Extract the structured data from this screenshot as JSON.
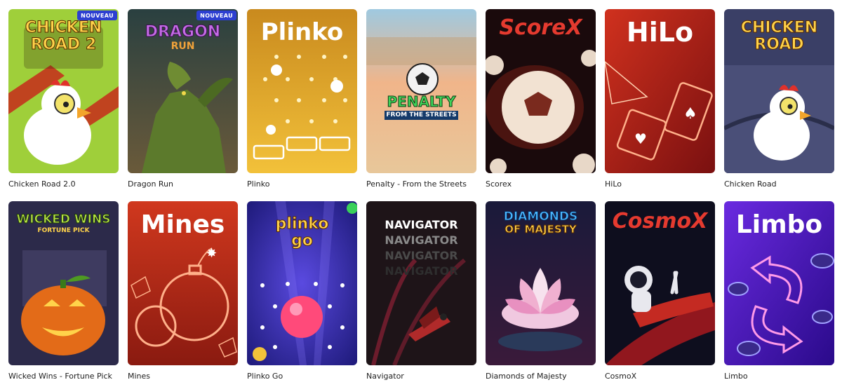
{
  "badge_new": "NOUVEAU",
  "games": [
    {
      "title": "Chicken Road 2.0",
      "logo": "CHICKEN",
      "logo2": "ROAD 2",
      "icon": "chicken-icon"
    },
    {
      "title": "Dragon Run",
      "logo": "DRAGON",
      "logo2": "RUN",
      "icon": "dragon-icon"
    },
    {
      "title": "Plinko",
      "logo": "Plinko",
      "icon": "plinko-board-icon"
    },
    {
      "title": "Penalty - From the Streets",
      "logo": "PENALTY",
      "logo2": "FROM THE STREETS",
      "icon": "soccer-ball-icon"
    },
    {
      "title": "Scorex",
      "logo": "ScoreX",
      "icon": "soccer-ball-icon"
    },
    {
      "title": "HiLo",
      "logo": "HiLo",
      "icon": "playing-cards-icon"
    },
    {
      "title": "Chicken Road",
      "logo": "CHICKEN",
      "logo2": "ROAD",
      "icon": "chicken-icon"
    },
    {
      "title": "Wicked Wins - Fortune Pick",
      "logo": "WICKED WINS",
      "logo2": "FORTUNE PICK",
      "icon": "pumpkin-icon"
    },
    {
      "title": "Mines",
      "logo": "Mines",
      "icon": "bomb-icon"
    },
    {
      "title": "Plinko Go",
      "logo": "plinko",
      "logo2": "go",
      "icon": "ball-icon"
    },
    {
      "title": "Navigator",
      "logo": "NAVIGATOR",
      "icon": "plane-icon"
    },
    {
      "title": "Diamonds of Majesty",
      "logo": "DIAMONDS",
      "logo2": "OF MAJESTY",
      "icon": "lotus-icon"
    },
    {
      "title": "CosmoX",
      "logo": "CosmoX",
      "icon": "astronaut-icon"
    },
    {
      "title": "Limbo",
      "logo": "Limbo",
      "icon": "arrows-icon"
    }
  ]
}
